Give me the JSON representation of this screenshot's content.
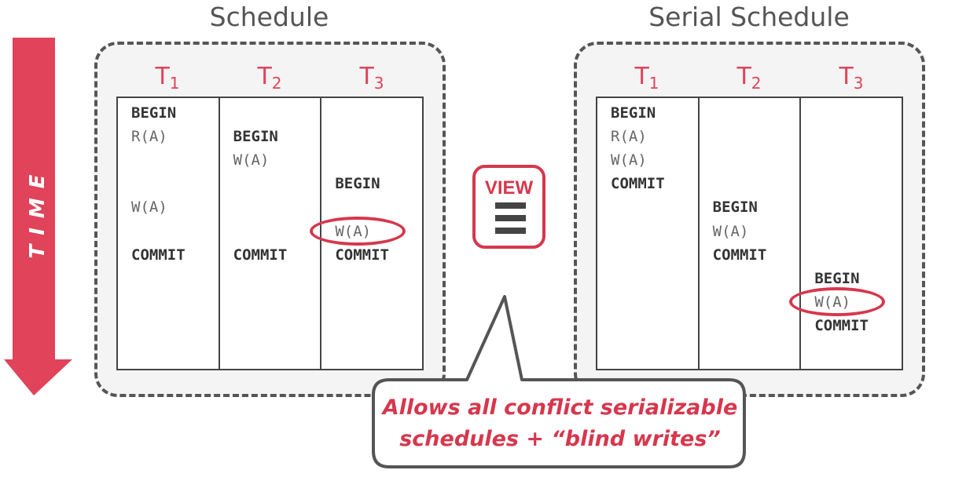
{
  "time_label": "TIME",
  "left": {
    "title": "Schedule",
    "columns": [
      {
        "name": "T",
        "sub": "1",
        "ops": [
          "BEGIN",
          "R(A)",
          "W(A)",
          "COMMIT"
        ]
      },
      {
        "name": "T",
        "sub": "2",
        "ops": [
          "BEGIN",
          "W(A)",
          "COMMIT"
        ]
      },
      {
        "name": "T",
        "sub": "3",
        "ops": [
          "BEGIN",
          "W(A)",
          "COMMIT"
        ]
      }
    ]
  },
  "right": {
    "title": "Serial Schedule",
    "columns": [
      {
        "name": "T",
        "sub": "1",
        "ops": [
          "BEGIN",
          "R(A)",
          "W(A)",
          "COMMIT"
        ]
      },
      {
        "name": "T",
        "sub": "2",
        "ops": [
          "BEGIN",
          "W(A)",
          "COMMIT"
        ]
      },
      {
        "name": "T",
        "sub": "3",
        "ops": [
          "BEGIN",
          "W(A)",
          "COMMIT"
        ]
      }
    ]
  },
  "equivalence": {
    "label": "VIEW",
    "symbol": "≡"
  },
  "callout": {
    "line1": "Allows all conflict serializable",
    "line2": "schedules + “blind writes”"
  },
  "colors": {
    "accent": "#e0435a",
    "outline": "#555555"
  }
}
